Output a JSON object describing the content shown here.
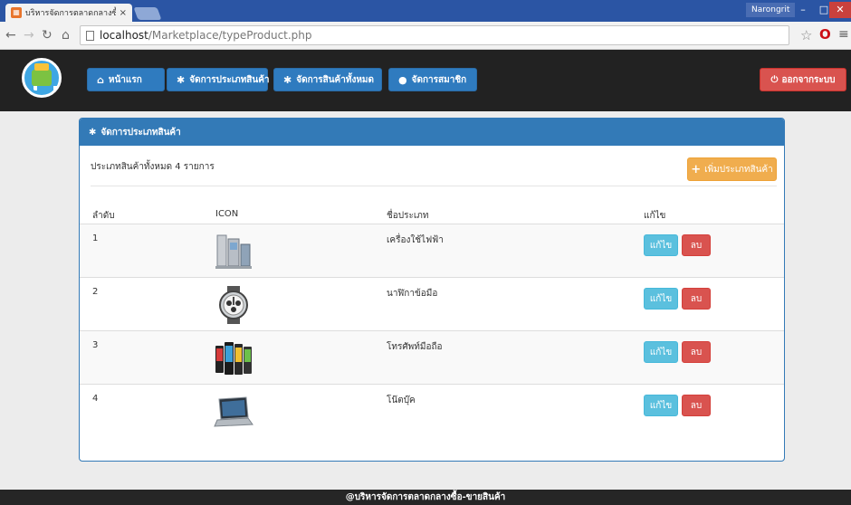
{
  "browser": {
    "tab_title": "บริหารจัดการตลาดกลางซื้อ-ข",
    "tab_close": "×",
    "user_badge": "Narongrit",
    "url_host": "localhost",
    "url_path": "/Marketplace/typeProduct.php"
  },
  "nav": {
    "home": "หน้าแรก",
    "types": "จัดการประเภทสินค้า",
    "products": "จัดการสินค้าทั้งหมด",
    "members": "จัดการสมาชิก",
    "logout": "ออกจากระบบ"
  },
  "panel": {
    "heading": "จัดการประเภทสินค้า",
    "summary": "ประเภทสินค้าทั้งหมด 4 รายการ",
    "add_button": "เพิ่มประเภทสินค้า",
    "columns": {
      "no": "ลำดับ",
      "icon": "ICON",
      "name": "ชื่อประเภท",
      "edit": "แก้ไข"
    },
    "rows": [
      {
        "no": "1",
        "name": "เครื่องใช้ไฟฟ้า",
        "icon": "appliances-icon"
      },
      {
        "no": "2",
        "name": "นาฬิกาข้อมือ",
        "icon": "wristwatch-icon"
      },
      {
        "no": "3",
        "name": "โทรศัพท์มือถือ",
        "icon": "mobile-phones-icon"
      },
      {
        "no": "4",
        "name": "โน๊ตบุ๊ค",
        "icon": "laptop-icon"
      }
    ],
    "edit_label": "แก้ไข",
    "delete_label": "ลบ"
  },
  "footer": {
    "text": "@บริหารจัดการตลาดกลางซื้อ-ขายสินค้า"
  },
  "colors": {
    "primary": "#337ab7",
    "warning": "#f0ad4e",
    "info": "#5bc0de",
    "danger": "#d9534f",
    "navbar": "#222222"
  }
}
